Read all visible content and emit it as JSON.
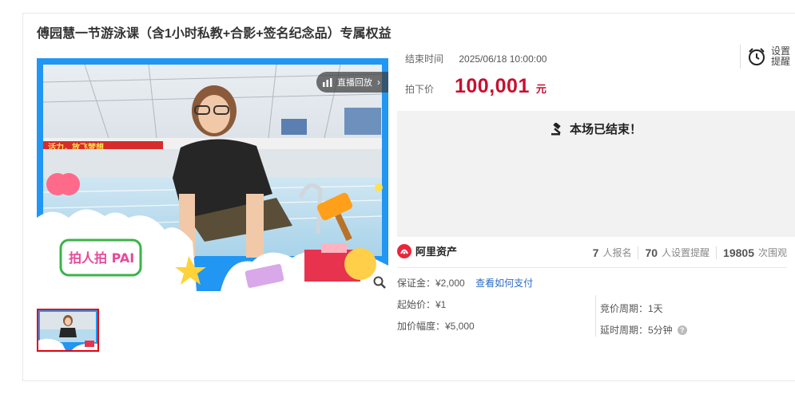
{
  "title": "傅园慧一节游泳课（含1小时私教+合影+签名纪念品）专属权益",
  "media": {
    "live_replay": "直播回放",
    "banner_left": "活力，放飞梦想",
    "promo_logo": "拍人拍 PAI"
  },
  "auction": {
    "end_label": "结束时间",
    "end_time": "2025/06/18 10:00:00",
    "price_label": "拍下价",
    "price": "100,001",
    "unit": "元",
    "remind_label": "设置提醒",
    "ended_text": "本场已结束！"
  },
  "stats": {
    "brand": "阿里资产",
    "signups": "7",
    "signups_label": "人报名",
    "reminders": "70",
    "reminders_label": "人设置提醒",
    "views": "19805",
    "views_label": "次围观"
  },
  "deposit": {
    "text": "保证金：¥2,000",
    "link": "查看如何支付"
  },
  "rules": {
    "start_price": "起始价：¥1",
    "increment": "加价幅度：¥5,000",
    "cycle": "竞价周期：1天",
    "delay": "延时周期：5分钟"
  },
  "colors": {
    "price": "#c8102e",
    "link": "#2c6cc4",
    "frame_blue": "#1e90ff"
  }
}
